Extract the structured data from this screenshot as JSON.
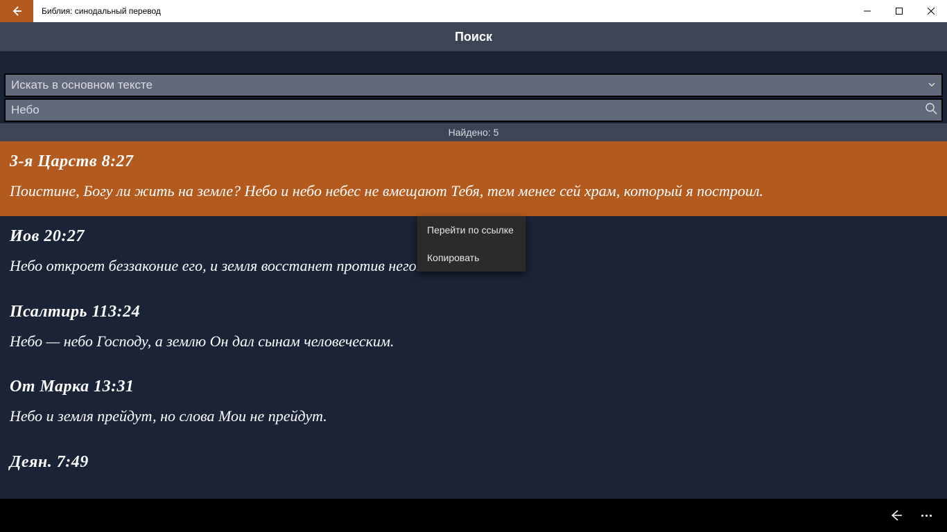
{
  "titlebar": {
    "app_title": "Библия: синодальный перевод"
  },
  "header": {
    "title": "Поиск"
  },
  "search": {
    "scope_label": "Искать в основном тексте",
    "query": "Небо",
    "found_label": "Найдено: 5"
  },
  "results": [
    {
      "ref": "3-я Царств 8:27",
      "text": "Поистине, Богу ли жить на земле? Небо и небо небес не вмещают Тебя, тем менее сей храм, который я построил.",
      "selected": true
    },
    {
      "ref": "Иов 20:27",
      "text": "Небо откроет беззаконие его, и земля восстанет против него.",
      "selected": false
    },
    {
      "ref": "Псалтирь 113:24",
      "text": "Небо — небо Господу, а землю Он дал сынам человеческим.",
      "selected": false
    },
    {
      "ref": "От Марка 13:31",
      "text": "Небо и земля прейдут, но слова Мои не прейдут.",
      "selected": false
    },
    {
      "ref": "Деян. 7:49",
      "text": "",
      "selected": false
    }
  ],
  "context_menu": {
    "open_link": "Перейти по ссылке",
    "copy": "Копировать"
  }
}
